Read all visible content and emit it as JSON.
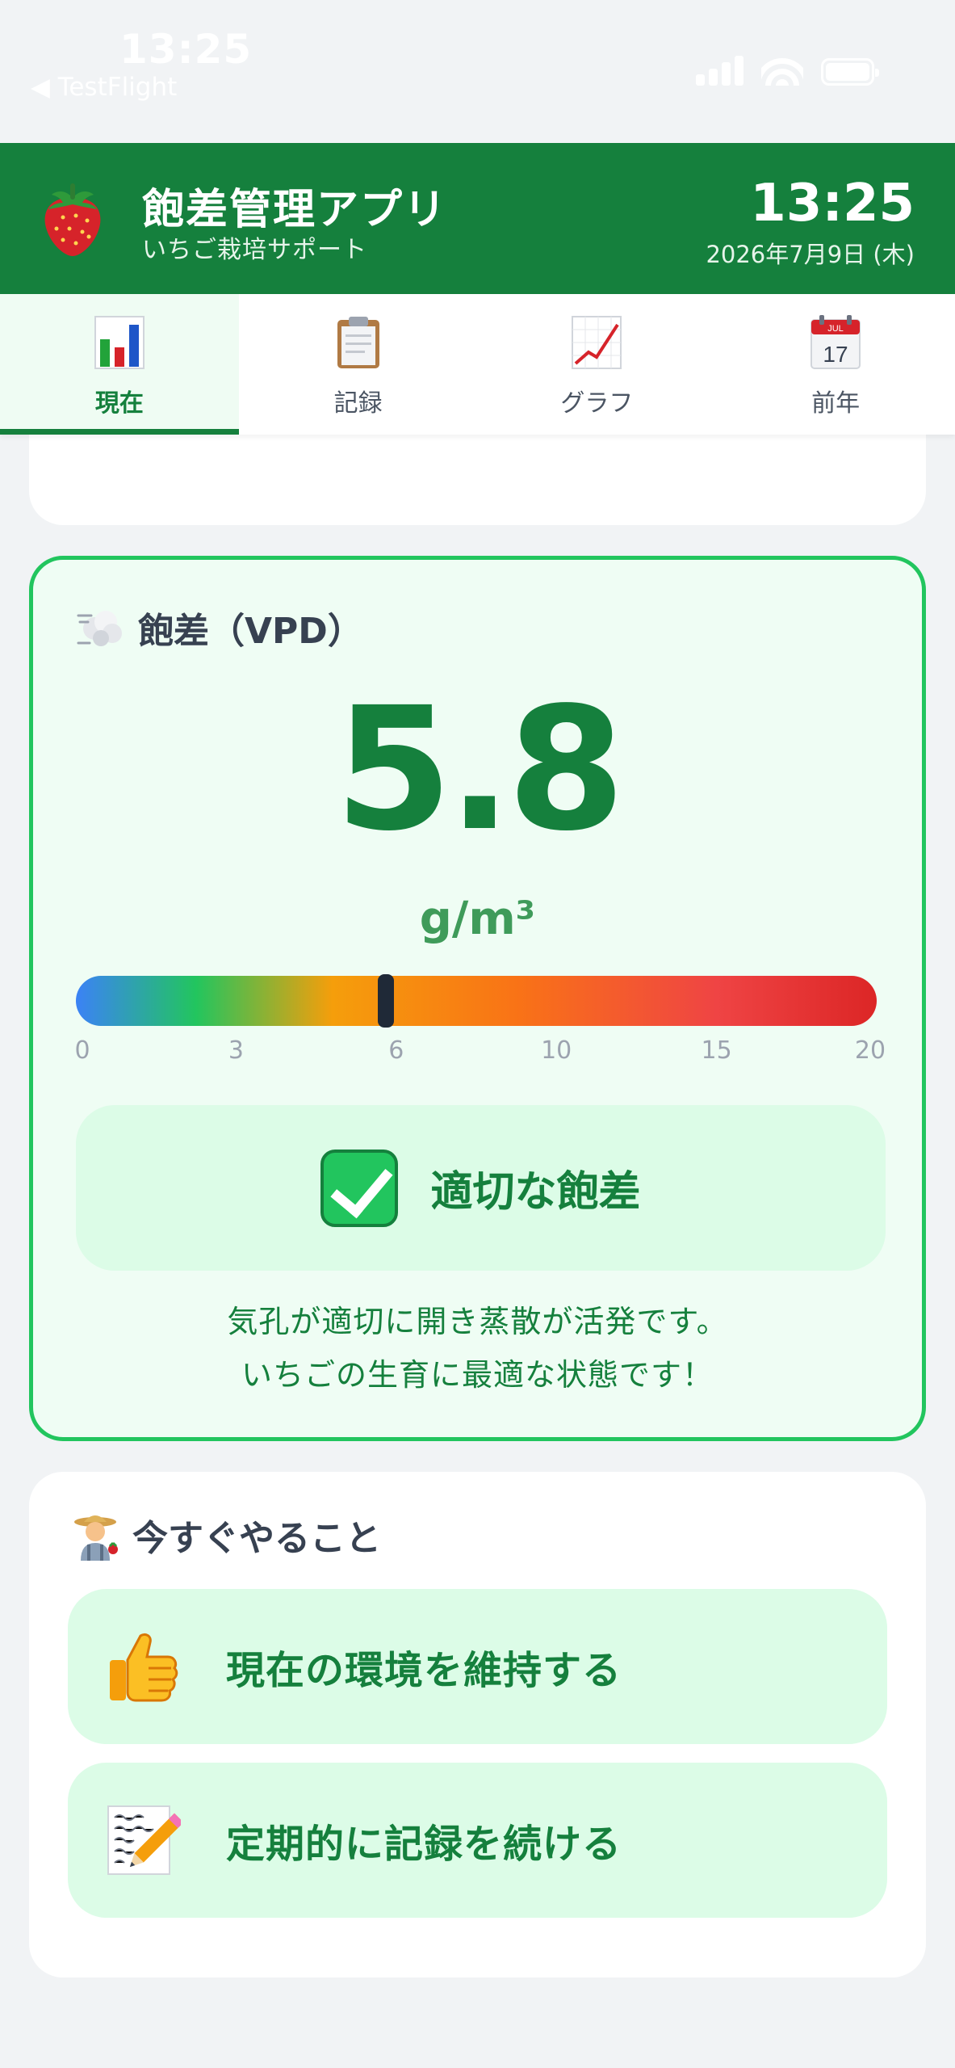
{
  "status_bar": {
    "time": "13:25",
    "back_label": "◀ TestFlight"
  },
  "header": {
    "logo_icon": "strawberry-icon",
    "title": "飽差管理アプリ",
    "subtitle": "いちご栽培サポート",
    "time": "13:25",
    "date": "2026年7月9日 (木)"
  },
  "tabs": [
    {
      "label": "現在",
      "icon": "bar-chart-icon",
      "active": true
    },
    {
      "label": "記録",
      "icon": "clipboard-icon",
      "active": false
    },
    {
      "label": "グラフ",
      "icon": "line-chart-icon",
      "active": false
    },
    {
      "label": "前年",
      "icon": "calendar-icon",
      "active": false
    }
  ],
  "calendar_icon": {
    "month": "JUL",
    "day": "17"
  },
  "vpd": {
    "icon": "wind-icon",
    "title": "飽差（VPD）",
    "value": "5.8",
    "unit": "g/m³",
    "gauge_max": 20,
    "marker_value": 5.8,
    "ticks": [
      "0",
      "3",
      "6",
      "10",
      "15",
      "20"
    ],
    "status_icon": "check-mark-icon",
    "status_label": "適切な飽差",
    "description_line1": "気孔が適切に開き蒸散が活発です。",
    "description_line2": "いちごの生育に最適な状態です！"
  },
  "actions": {
    "icon": "farmer-icon",
    "title": "今すぐやること",
    "items": [
      {
        "icon": "thumbs-up-icon",
        "label": "現在の環境を維持する"
      },
      {
        "icon": "memo-icon",
        "label": "定期的に記録を続ける"
      }
    ]
  },
  "colors": {
    "primary": "#15803d",
    "success_border": "#22c55e",
    "card_tint": "#effdf4",
    "status_bg": "#dcfce7"
  }
}
